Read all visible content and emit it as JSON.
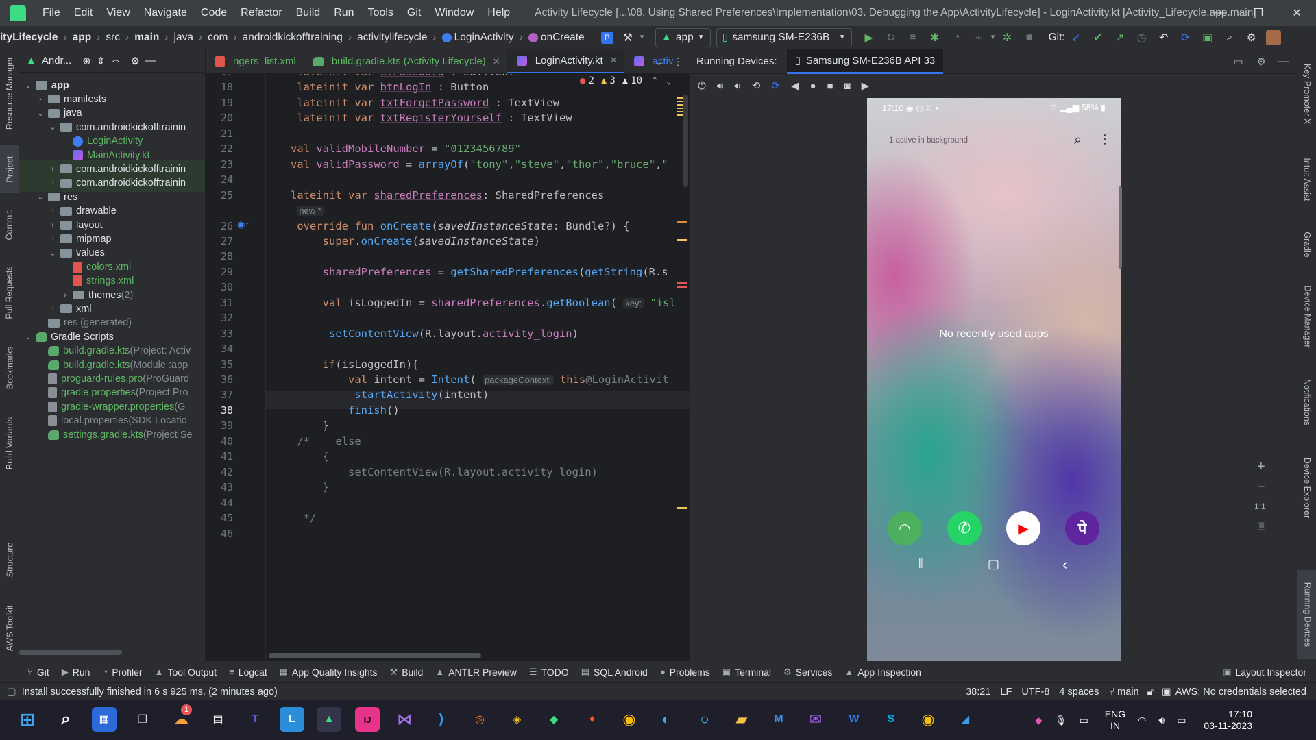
{
  "window": {
    "menu": [
      "File",
      "Edit",
      "View",
      "Navigate",
      "Code",
      "Refactor",
      "Build",
      "Run",
      "Tools",
      "Git",
      "Window",
      "Help"
    ],
    "title": "Activity Lifecycle [...\\08. Using Shared Preferences\\Implementation\\03. Debugging the App\\ActivityLifecycle] - LoginActivity.kt [Activity_Lifecycle.app.main]",
    "controls": [
      "—",
      "❐",
      "✕"
    ]
  },
  "navbar": {
    "crumbs": [
      "ityLifecycle",
      "app",
      "src",
      "main",
      "java",
      "com",
      "androidkickofftraining",
      "activitylifecycle",
      "LoginActivity",
      "onCreate"
    ],
    "run_config": "app",
    "device": "samsung SM-E236B",
    "git_label": "Git:"
  },
  "left_stripe": [
    "Resource Manager",
    "Project",
    "Commit",
    "Pull Requests",
    "Bookmarks",
    "Build Variants",
    "Structure",
    "AWS Toolkit"
  ],
  "right_stripe": [
    "Key Promoter X",
    "Intuit Assist",
    "Gradle",
    "Device Manager",
    "Notifications",
    "Device Explorer",
    "Running Devices"
  ],
  "project": {
    "header": "Andr...",
    "tree": [
      {
        "label": "app",
        "indent": 0,
        "icon": "folder",
        "open": "v",
        "bold": true
      },
      {
        "label": "manifests",
        "indent": 1,
        "icon": "folder",
        "open": ">"
      },
      {
        "label": "java",
        "indent": 1,
        "icon": "folder",
        "open": "v"
      },
      {
        "label": "com.androidkickofftrainin",
        "indent": 2,
        "icon": "folder",
        "open": "v"
      },
      {
        "label": "LoginActivity",
        "indent": 3,
        "icon": "kt-act",
        "open": "",
        "color": "green"
      },
      {
        "label": "MainActivity.kt",
        "indent": 3,
        "icon": "kt",
        "open": "",
        "color": "green"
      },
      {
        "label": "com.androidkickofftrainin",
        "indent": 2,
        "icon": "folder",
        "open": ">",
        "hl": true
      },
      {
        "label": "com.androidkickofftrainin",
        "indent": 2,
        "icon": "folder",
        "open": ">",
        "hl": true
      },
      {
        "label": "res",
        "indent": 1,
        "icon": "folder",
        "open": "v"
      },
      {
        "label": "drawable",
        "indent": 2,
        "icon": "folder",
        "open": ">"
      },
      {
        "label": "layout",
        "indent": 2,
        "icon": "folder",
        "open": ">"
      },
      {
        "label": "mipmap",
        "indent": 2,
        "icon": "folder",
        "open": ">"
      },
      {
        "label": "values",
        "indent": 2,
        "icon": "folder",
        "open": "v"
      },
      {
        "label": "colors.xml",
        "indent": 3,
        "icon": "xml",
        "open": "",
        "color": "green"
      },
      {
        "label": "strings.xml",
        "indent": 3,
        "icon": "xml",
        "open": "",
        "color": "green"
      },
      {
        "label": "themes",
        "suffix": " (2)",
        "indent": 3,
        "icon": "folder",
        "open": ">"
      },
      {
        "label": "xml",
        "indent": 2,
        "icon": "folder",
        "open": ">"
      },
      {
        "label": "res (generated)",
        "indent": 1,
        "icon": "folder",
        "open": "",
        "color": "gray"
      },
      {
        "label": "Gradle Scripts",
        "indent": 0,
        "icon": "gradle",
        "open": "v"
      },
      {
        "label": "build.gradle.kts",
        "suffix": " (Project: Activ",
        "indent": 1,
        "icon": "gradle",
        "open": "",
        "color": "green"
      },
      {
        "label": "build.gradle.kts",
        "suffix": " (Module :app",
        "indent": 1,
        "icon": "gradle",
        "open": "",
        "color": "green"
      },
      {
        "label": "proguard-rules.pro",
        "suffix": " (ProGuard",
        "indent": 1,
        "icon": "prop",
        "open": "",
        "color": "green"
      },
      {
        "label": "gradle.properties",
        "suffix": " (Project Pro",
        "indent": 1,
        "icon": "prop",
        "open": "",
        "color": "green"
      },
      {
        "label": "gradle-wrapper.properties",
        "suffix": " (G",
        "indent": 1,
        "icon": "prop",
        "open": "",
        "color": "green"
      },
      {
        "label": "local.properties",
        "suffix": " (SDK Locatio",
        "indent": 1,
        "icon": "prop",
        "open": "",
        "color": "gray"
      },
      {
        "label": "settings.gradle.kts",
        "suffix": " (Project Se",
        "indent": 1,
        "icon": "gradle",
        "open": "",
        "color": "green"
      }
    ]
  },
  "editor": {
    "tabs": [
      {
        "label": "ngers_list.xml",
        "icon": "xml"
      },
      {
        "label": "build.gradle.kts (Activity Lifecycle)",
        "icon": "gradle",
        "close": "✕"
      },
      {
        "label": "LoginActivity.kt",
        "icon": "kt",
        "close": "✕",
        "selected": true
      },
      {
        "label": "activ",
        "icon": "kt"
      }
    ],
    "inspections": {
      "errors": "2",
      "warnings": "3",
      "weak": "10"
    },
    "lines": [
      {
        "n": "17",
        "html": "    <span class='kw'>lateinit var</span> <span class='prop'>etPassword</span> : EditText"
      },
      {
        "n": "18",
        "html": "    <span class='kw'>lateinit var</span> <span class='prop'>btnLogIn</span> : Button"
      },
      {
        "n": "19",
        "html": "    <span class='kw'>lateinit var</span> <span class='prop'>txtForgetPassword</span> : TextView"
      },
      {
        "n": "20",
        "html": "    <span class='kw'>lateinit var</span> <span class='prop'>txtRegisterYourself</span> : TextView"
      },
      {
        "n": "21",
        "html": ""
      },
      {
        "n": "22",
        "html": "   <span class='kw'>val</span> <span class='prop'>validMobileNumber</span> = <span class='str'>\"0123456789\"</span>"
      },
      {
        "n": "23",
        "html": "   <span class='kw'>val</span> <span class='prop'>validPassword</span> = <span class='fn'>arrayOf</span>(<span class='str'>\"tony\"</span>,<span class='str'>\"steve\"</span>,<span class='str'>\"thor\"</span>,<span class='str'>\"bruce\"</span>,<span class='str'>\"</span>"
      },
      {
        "n": "24",
        "html": ""
      },
      {
        "n": "25",
        "html": "   <span class='kw'>lateinit var</span> <span class='prop'>sharedPreferences</span>: SharedPreferences"
      },
      {
        "n": "",
        "html": "    <span class='hint'>new *</span>"
      },
      {
        "n": "26",
        "html": "    <span class='kw'>override fun</span> <span class='fn'>onCreate</span>(<span class='it'>savedInstanceState</span>: Bundle?) {"
      },
      {
        "n": "27",
        "html": "        <span class='kw'>super</span>.<span class='fn'>onCreate</span>(<span class='it'>savedInstanceState</span>)"
      },
      {
        "n": "28",
        "html": ""
      },
      {
        "n": "29",
        "html": "        <span class='prop' style='text-decoration:none'>sharedPreferences</span> = <span class='fn'>getSharedPreferences</span>(<span class='fn'>getString</span>(R.s"
      },
      {
        "n": "30",
        "html": ""
      },
      {
        "n": "31",
        "html": "        <span class='kw'>val</span> isLoggedIn = <span class='prop' style='text-decoration:none'>sharedPreferences</span>.<span class='fn'>getBoolean</span>( <span class='hint'>key:</span> <span class='str'>\"isl</span>"
      },
      {
        "n": "32",
        "html": ""
      },
      {
        "n": "33",
        "html": "         <span class='fn'>setContentView</span>(R.layout.<span class='prop' style='text-decoration:none'>activity_login</span>)"
      },
      {
        "n": "34",
        "html": ""
      },
      {
        "n": "35",
        "html": "        <span class='kw'>if</span>(isLoggedIn){"
      },
      {
        "n": "36",
        "html": "            <span class='kw'>val</span> intent = <span class='fn'>Intent</span>( <span class='hint'>packageContext:</span> <span class='kw'>this</span><span class='cmt'>@LoginActivit</span>"
      },
      {
        "n": "37",
        "html": "             <span class='fn'>startActivity</span>(intent)"
      },
      {
        "n": "38",
        "html": "            <span class='fn'>finish</span>()"
      },
      {
        "n": "39",
        "html": "        }"
      },
      {
        "n": "40",
        "html": "    <span class='cmt'>/*    else</span>"
      },
      {
        "n": "41",
        "html": "<span class='cmt'>        {</span>"
      },
      {
        "n": "42",
        "html": "<span class='cmt'>            setContentView(R.layout.activity_login)</span>"
      },
      {
        "n": "43",
        "html": "<span class='cmt'>        }</span>"
      },
      {
        "n": "44",
        "html": ""
      },
      {
        "n": "45",
        "html": "<span class='cmt'>     */</span>"
      },
      {
        "n": "46",
        "html": ""
      }
    ]
  },
  "devices": {
    "label": "Running Devices:",
    "tab": "Samsung SM-E236B API 33",
    "phone": {
      "time": "17:10",
      "battery": "58%",
      "bg_text": "1 active in background",
      "empty_text": "No recently used apps",
      "zoom": "1:1"
    }
  },
  "toolstrip": [
    "Git",
    "Run",
    "Profiler",
    "Tool Output",
    "Logcat",
    "App Quality Insights",
    "Build",
    "ANTLR Preview",
    "TODO",
    "SQL Android",
    "Problems",
    "Terminal",
    "Services",
    "App Inspection"
  ],
  "layout_inspector": "Layout Inspector",
  "statusbar": {
    "message": "Install successfully finished in 6 s 925 ms. (2 minutes ago)",
    "position": "38:21",
    "line_sep": "LF",
    "encoding": "UTF-8",
    "indent": "4 spaces",
    "branch": "main",
    "aws": "AWS: No credentials selected"
  },
  "taskbar": {
    "lang": "ENG",
    "region": "IN",
    "time": "17:10",
    "date": "03-11-2023",
    "notif_badge": "1"
  }
}
